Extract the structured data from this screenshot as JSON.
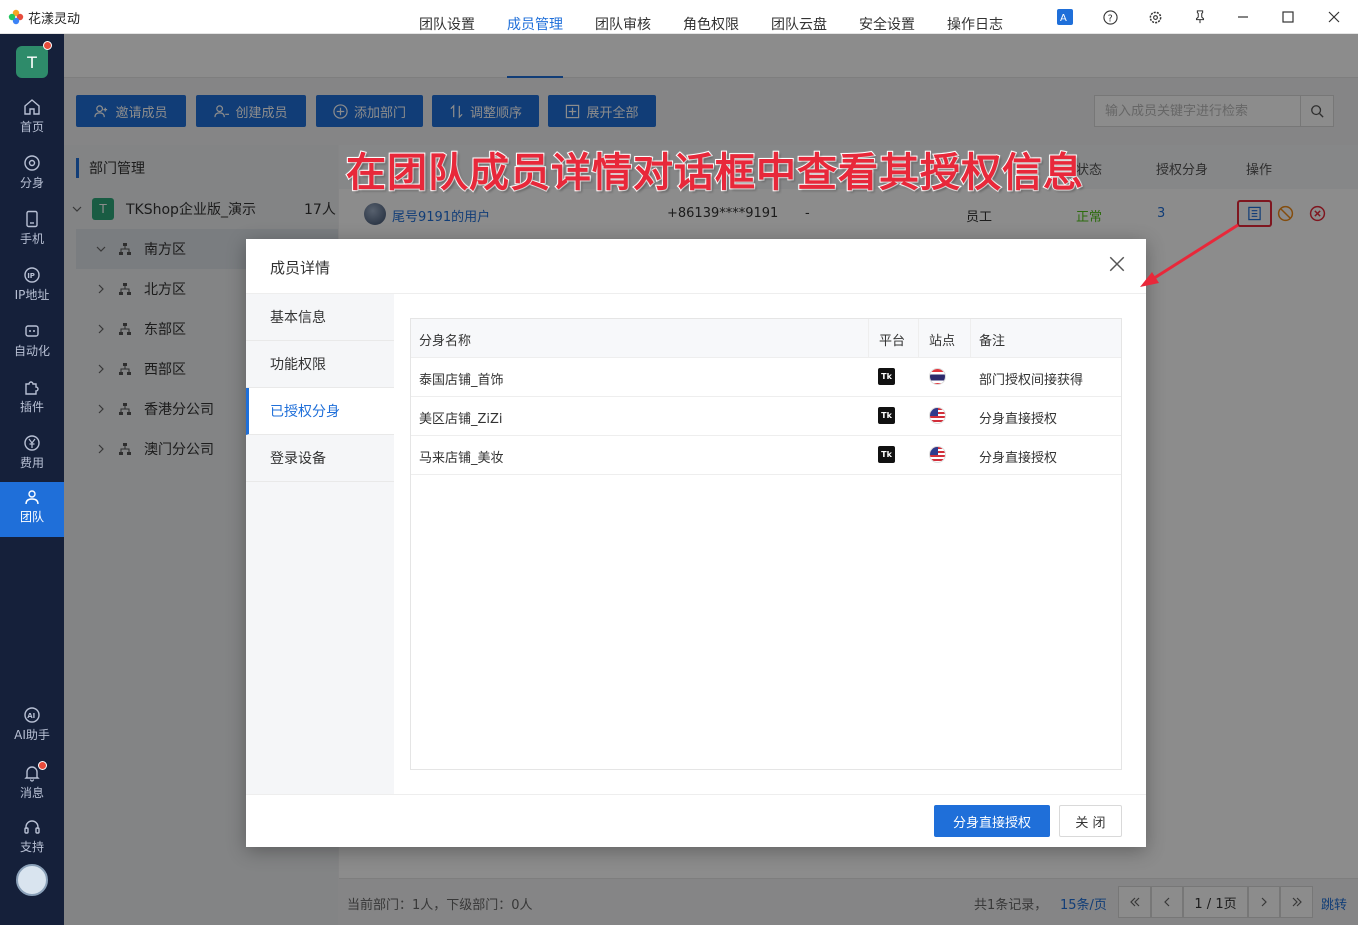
{
  "app": {
    "title": "花漾灵动"
  },
  "sidebar": {
    "avatar_letter": "T",
    "items": [
      {
        "label": "首页",
        "icon": "home-icon"
      },
      {
        "label": "分身",
        "icon": "chrome-icon"
      },
      {
        "label": "手机",
        "icon": "phone-icon"
      },
      {
        "label": "IP地址",
        "icon": "ip-icon"
      },
      {
        "label": "自动化",
        "icon": "robot-icon"
      },
      {
        "label": "插件",
        "icon": "puzzle-icon"
      },
      {
        "label": "费用",
        "icon": "yen-icon"
      },
      {
        "label": "团队",
        "icon": "team-icon",
        "active": true
      }
    ],
    "bottom": [
      {
        "label": "AI助手",
        "icon": "ai-icon"
      },
      {
        "label": "消息",
        "icon": "bell-icon"
      },
      {
        "label": "支持",
        "icon": "headset-icon"
      }
    ]
  },
  "tabs": [
    {
      "label": "团队设置"
    },
    {
      "label": "成员管理",
      "active": true
    },
    {
      "label": "团队审核"
    },
    {
      "label": "角色权限"
    },
    {
      "label": "团队云盘"
    },
    {
      "label": "安全设置"
    },
    {
      "label": "操作日志"
    }
  ],
  "toolbar": {
    "invite": "邀请成员",
    "create": "创建成员",
    "add_dept": "添加部门",
    "reorder": "调整顺序",
    "expand": "展开全部",
    "search_placeholder": "输入成员关键字进行检索"
  },
  "dept": {
    "header": "部门管理",
    "root_letter": "T",
    "root_name": "TKShop企业版_演示",
    "root_count": "17人",
    "children": [
      "南方区",
      "北方区",
      "东部区",
      "西部区",
      "香港分公司",
      "澳门分公司"
    ]
  },
  "table": {
    "headers": {
      "status": "状态",
      "auth": "授权分身",
      "ops": "操作"
    },
    "row": {
      "name": "尾号9191的用户",
      "phone": "+86139****9191",
      "dash": "-",
      "role": "员工",
      "status": "正常",
      "auth_count": "3"
    }
  },
  "footer": {
    "dept_info": "当前部门：1人，下级部门：0人",
    "total": "共1条记录，",
    "page_size": "15条/页",
    "page": "1 / 1页",
    "jump": "跳转"
  },
  "annotation": "在团队成员详情对话框中查看其授权信息",
  "modal": {
    "title": "成员详情",
    "tabs": [
      {
        "label": "基本信息"
      },
      {
        "label": "功能权限"
      },
      {
        "label": "已授权分身",
        "active": true
      },
      {
        "label": "登录设备"
      }
    ],
    "columns": {
      "name": "分身名称",
      "platform": "平台",
      "site": "站点",
      "note": "备注"
    },
    "rows": [
      {
        "name": "泰国店铺_首饰",
        "platform": "TK",
        "site": "thailand-flag",
        "note": "部门授权间接获得"
      },
      {
        "name": "美区店铺_ZiZi",
        "platform": "TK",
        "site": "us-flag",
        "note": "分身直接授权"
      },
      {
        "name": "马来店铺_美妆",
        "platform": "TK",
        "site": "us-flag",
        "note": "分身直接授权"
      }
    ],
    "primary_button": "分身直接授权",
    "close_button": "关 闭"
  },
  "colors": {
    "accent": "#1f6fd9",
    "sidebar": "#15203a",
    "danger": "#e8283a",
    "success": "#52c41a"
  }
}
